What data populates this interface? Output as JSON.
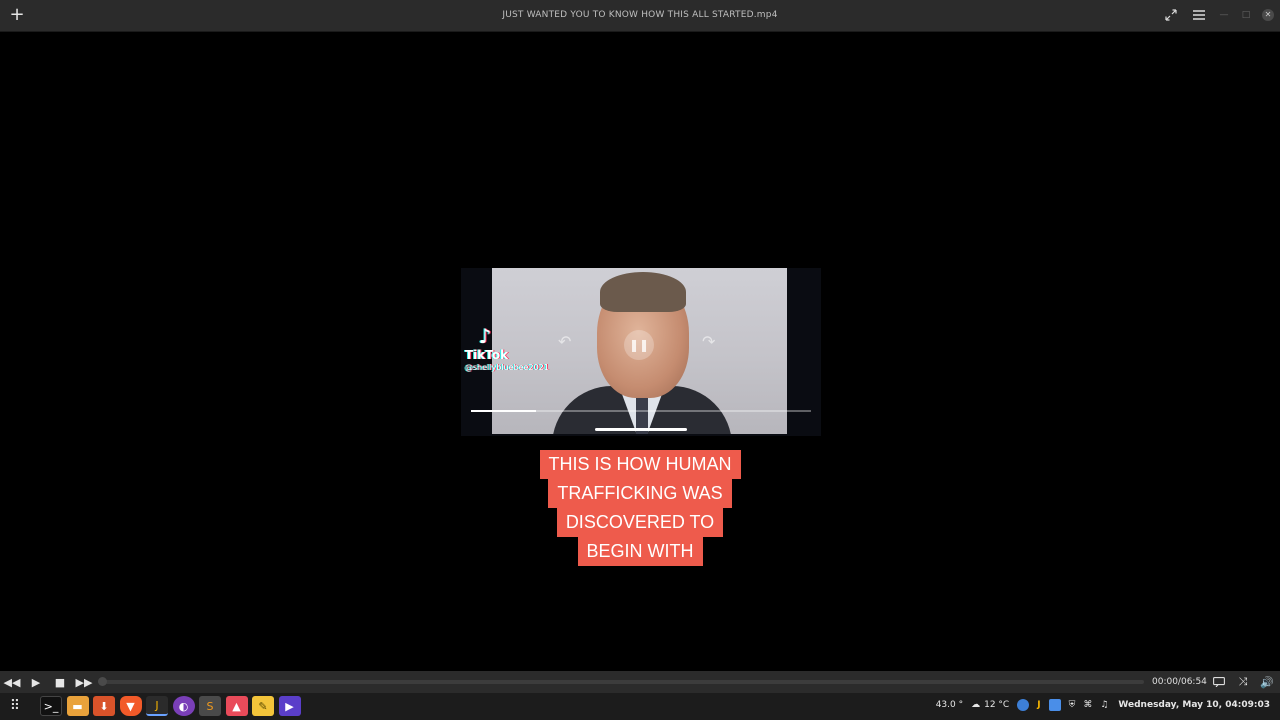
{
  "window": {
    "title": "JUST WANTED YOU TO KNOW HOW THIS ALL STARTED.mp4"
  },
  "video": {
    "tiktok_brand": "TikTok",
    "tiktok_user": "@shellybluebee2021",
    "caption_lines": [
      "THIS IS HOW HUMAN",
      "TRAFFICKING WAS",
      "DISCOVERED TO",
      "BEGIN WITH"
    ],
    "embedded_progress": 0.19
  },
  "player": {
    "time": "00:00/06:54",
    "progress": 0.0
  },
  "taskbar": {
    "apps": [
      "terminal-icon",
      "files-icon",
      "downloader-icon",
      "brave-icon",
      "jdownloader-icon",
      "tor-browser-icon",
      "sublime-text-icon",
      "image-viewer-icon",
      "notes-icon",
      "video-player-icon"
    ],
    "cpu_temp": "43.0 °",
    "weather": "12 °C",
    "clock": "Wednesday, May 10, 04:09:03"
  },
  "colors": {
    "caption_bg": "#ee5b4c",
    "titlebar_bg": "#2b2b2b",
    "taskbar_bg": "#1c1c1c"
  }
}
